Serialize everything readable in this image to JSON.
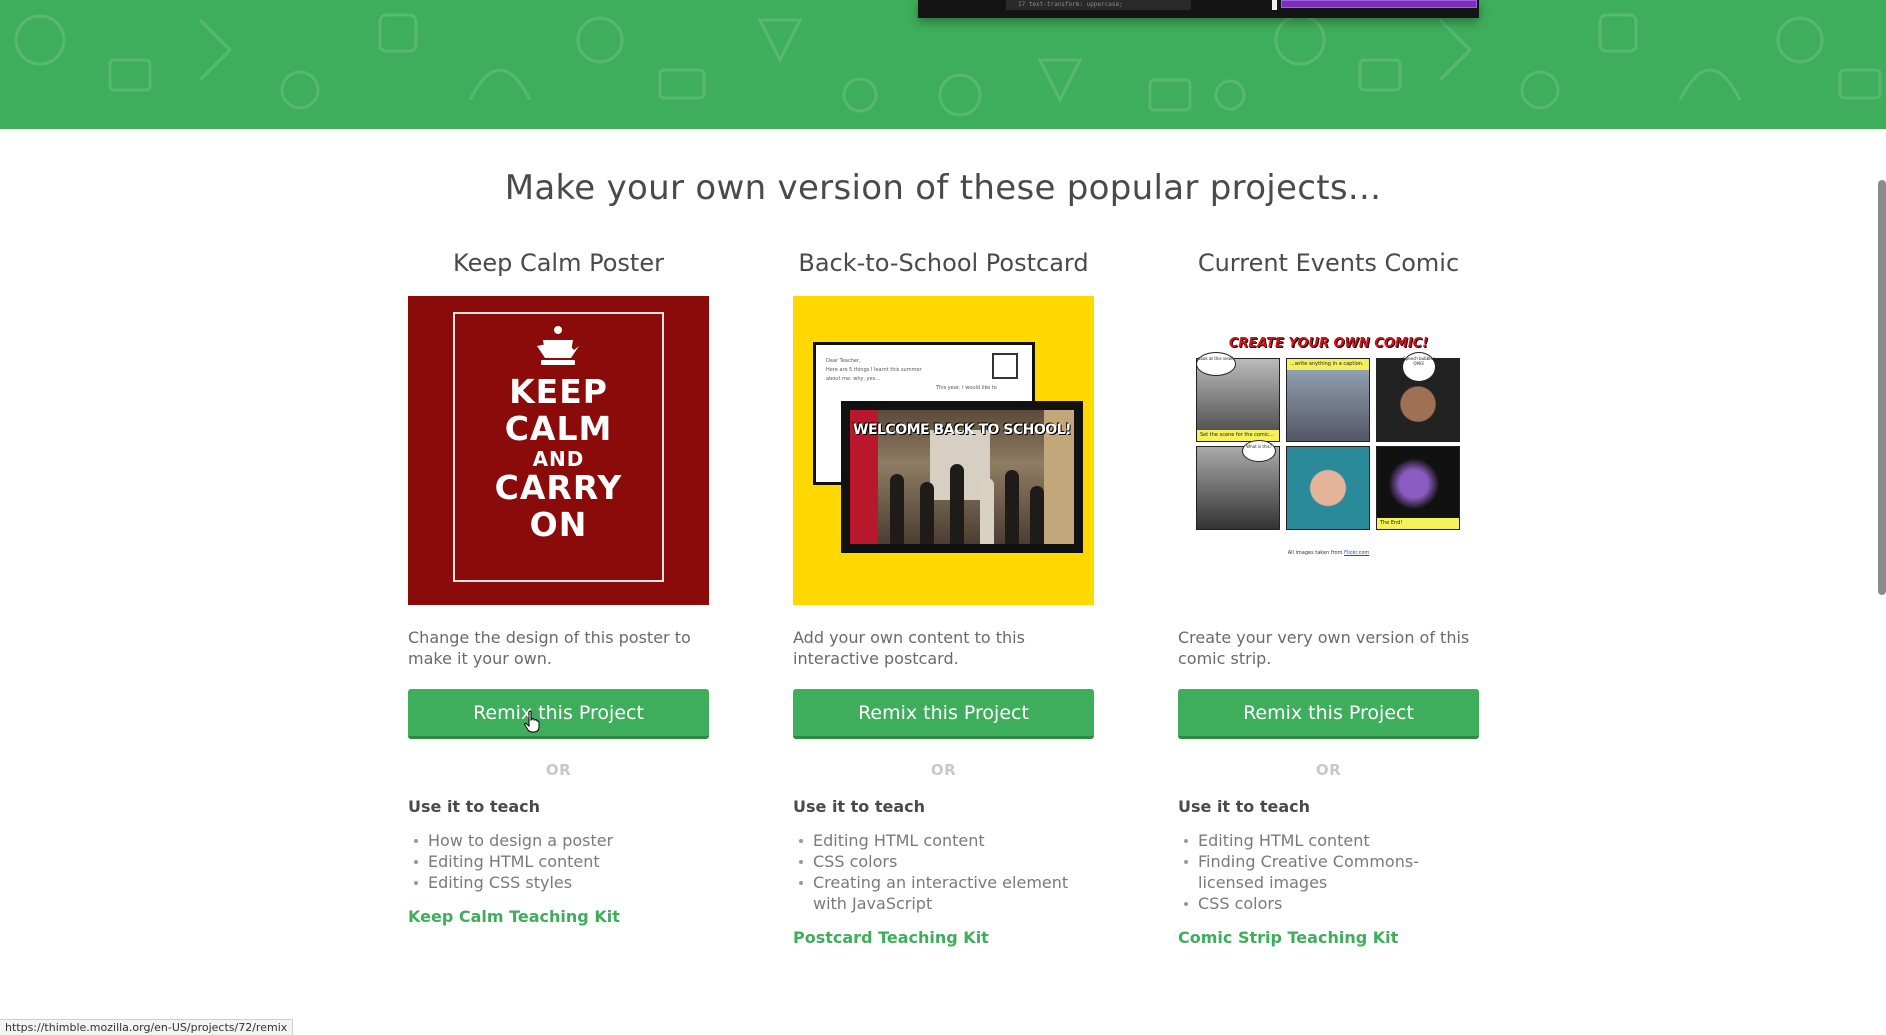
{
  "hero": {
    "code_line": "17    text-transform: uppercase;"
  },
  "heading": "Make your own version of these popular projects...",
  "projects": [
    {
      "title": "Keep Calm Poster",
      "poster": {
        "line1": "KEEP",
        "line2": "CALM",
        "line3": "AND",
        "line4": "CARRY",
        "line5": "ON"
      },
      "description": "Change the design of this poster to make it your own.",
      "button": "Remix this Project",
      "or": "OR",
      "teach_heading": "Use it to teach",
      "teach_items": [
        "How to design a poster",
        "Editing HTML content",
        "Editing CSS styles"
      ],
      "kit_link": "Keep Calm Teaching Kit"
    },
    {
      "title": "Back-to-School Postcard",
      "postcard": {
        "greeting": "Dear Teacher,",
        "body1": "Here are 5 things I learnt this summer",
        "body2": "about me: why, yes...",
        "note": "This year, I would like to",
        "photo_title": "WELCOME BACK TO SCHOOL!"
      },
      "description": "Add your own content to this interactive postcard.",
      "button": "Remix this Project",
      "or": "OR",
      "teach_heading": "Use it to teach",
      "teach_items": [
        "Editing HTML content",
        "CSS colors",
        "Creating an interactive element with JavaScript"
      ],
      "kit_link": "Postcard Teaching Kit"
    },
    {
      "title": "Current Events Comic",
      "comic": {
        "title": "CREATE YOUR OWN COMIC!",
        "bubble1": "Look at this view!",
        "bubble2": "Speech bubbles OMG!",
        "bubble3": "What is this?",
        "cap1": "Set the scene for the comic...",
        "cap2": "...write anything in a caption.",
        "cap3": "The End!",
        "credit_text": "All images taken from",
        "credit_link": "Flickr.com"
      },
      "description": "Create your very own version of this comic strip.",
      "button": "Remix this Project",
      "or": "OR",
      "teach_heading": "Use it to teach",
      "teach_items": [
        "Editing HTML content",
        "Finding Creative Commons-licensed images",
        "CSS colors"
      ],
      "kit_link": "Comic Strip Teaching Kit"
    }
  ],
  "status_bar": "https://thimble.mozilla.org/en-US/projects/72/remix",
  "colors": {
    "accent_green": "#3fae5c",
    "poster_red": "#8b0a0a",
    "postcard_yellow": "#ffd800",
    "hero_green": "#3fae5c"
  }
}
